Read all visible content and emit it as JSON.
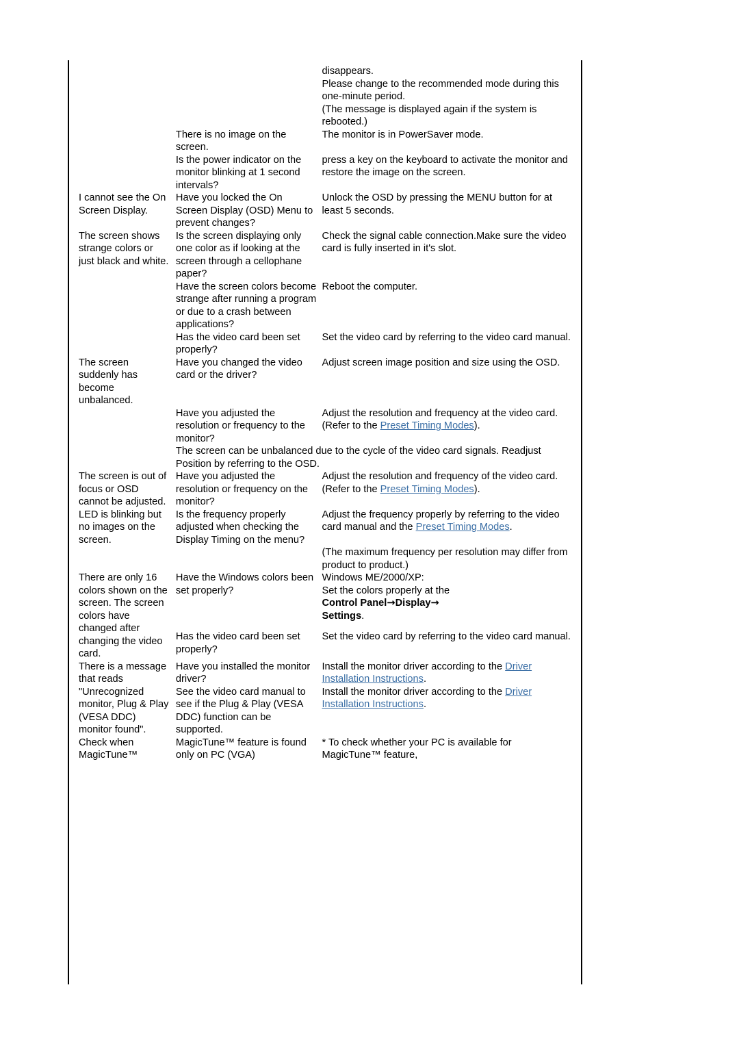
{
  "document": {
    "rows": [
      {
        "symptom": "",
        "checklist": "",
        "solution": "disappears.\nPlease change to the recommended mode during this one-minute period."
      },
      {
        "symptom": "",
        "checklist": "",
        "solution": "(The message is displayed again if the system is rebooted.)"
      },
      {
        "symptom": "",
        "checklist": "There is no image on the screen.",
        "solution": "The monitor is in PowerSaver mode."
      },
      {
        "symptom": "",
        "checklist": "Is the power indicator on the monitor blinking at 1 second intervals?",
        "solution": "press a key on the keyboard to activate the monitor and restore the image on the screen."
      },
      {
        "symptom": "I cannot see the On Screen Display.",
        "checklist": "Have you locked the On Screen Display (OSD) Menu to prevent changes?",
        "solution": "Unlock the OSD by pressing the MENU button for at least 5 seconds."
      },
      {
        "symptom": "The screen shows strange colors or just black and white.",
        "checklist": "Is the screen displaying only one color as if looking at the screen through a cellophane paper?",
        "solution": "Check the signal cable connection.Make sure the video card is fully inserted in it's slot."
      },
      {
        "symptom": "",
        "checklist": "Have the screen colors become strange after running a program or due to a crash between applications?",
        "solution": "Reboot the computer."
      },
      {
        "symptom": "",
        "checklist": "Has the video card been set properly?",
        "solution": "Set the video card by referring to the video card manual."
      },
      {
        "symptom": "The screen suddenly has become unbalanced.",
        "checklist": "Have you changed the video card or the driver?",
        "solution": "Adjust screen image position and size using the OSD."
      },
      {
        "symptom": "",
        "checklist": "Have you adjusted the resolution or frequency to the monitor?",
        "solution_pre": "Adjust the resolution and frequency at the video card.\n(Refer to the ",
        "solution_link": "Preset Timing Modes",
        "solution_post": ")."
      },
      {
        "symptom": "",
        "checklist_wide": "The screen can be unbalanced due to the cycle of the video card signals. Readjust Position by referring to the OSD."
      },
      {
        "symptom": "The screen is out of focus or OSD cannot be adjusted.",
        "checklist": "Have you adjusted the resolution or frequency on the monitor?",
        "solution_pre": "Adjust the resolution and frequency of the video card.\n(Refer to the ",
        "solution_link": "Preset Timing Modes",
        "solution_post": ")."
      },
      {
        "symptom": "LED is blinking but no images on the screen.",
        "checklist": "Is the frequency properly adjusted when checking the Display Timing on the menu?",
        "solution_pre": "Adjust the frequency properly by referring to the video card manual and the ",
        "solution_link": "Preset Timing Modes",
        "solution_post": "."
      },
      {
        "symptom": "",
        "checklist": "",
        "solution": "(The maximum frequency per resolution may differ from product to product.)"
      },
      {
        "symptom": "There are only 16 colors shown on the screen. The screen colors have changed after changing the video card.",
        "checklist": "Have the Windows colors been set properly?",
        "solution_os": "Windows ME/2000/XP:",
        "solution_line2": "Set the colors properly at the",
        "solution_path1": "Control Panel",
        "solution_arrow1": "→",
        "solution_path2": "Display",
        "solution_arrow2": "→",
        "solution_path3": "Settings",
        "solution_period": "."
      },
      {
        "symptom": "",
        "checklist": "Has the video card been set properly?",
        "solution": "Set the video card by referring to the video card manual."
      },
      {
        "symptom": "There is a message that reads \"Unrecognized monitor, Plug & Play (VESA DDC) monitor found\".",
        "checklist": "Have you installed the monitor driver?",
        "solution_pre": "Install the monitor driver according to the ",
        "solution_link": "Driver Installation Instructions",
        "solution_post": "."
      },
      {
        "symptom": "",
        "checklist": "See the video card manual to see if the Plug & Play (VESA DDC) function can be supported.",
        "solution_pre": "Install the monitor driver according to the ",
        "solution_link": "Driver Installation Instructions",
        "solution_post": "."
      },
      {
        "symptom": "Check when MagicTune™",
        "checklist": "MagicTune™ feature is found only on PC (VGA)",
        "solution": "* To check whether your PC is available for MagicTune™ feature,"
      }
    ]
  },
  "colors": {
    "link": "#3a6ea5",
    "text": "#000000",
    "rule": "#000000"
  }
}
